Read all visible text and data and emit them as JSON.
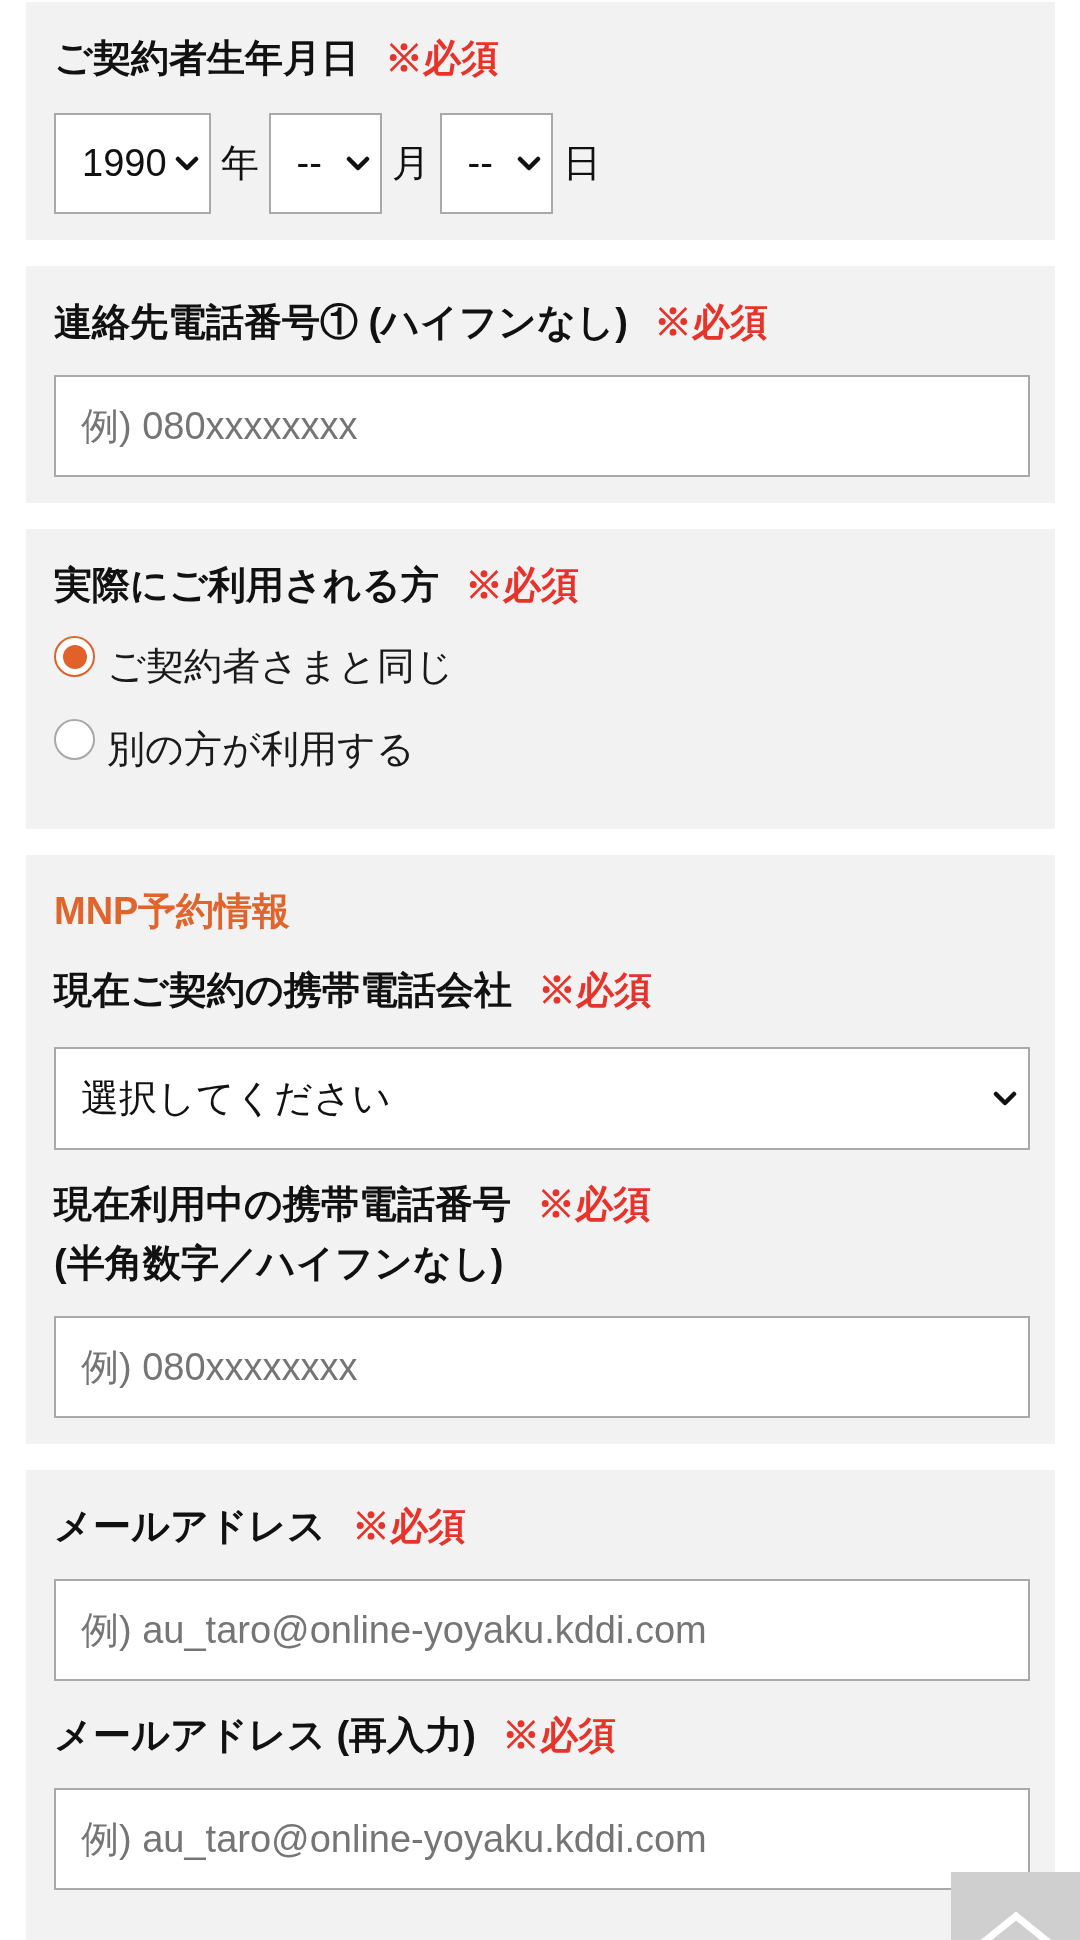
{
  "sections": [
    {
      "fields": [
        {
          "kind": "date",
          "label": "ご契約者生年月日",
          "required": "※必須",
          "selects": [
            {
              "value": "1990",
              "unit": "年"
            },
            {
              "value": "--",
              "unit": "月"
            },
            {
              "value": "--",
              "unit": "日"
            }
          ]
        }
      ]
    },
    {
      "fields": [
        {
          "kind": "text",
          "label": "連絡先電話番号① (ハイフンなし)",
          "required": "※必須",
          "placeholder": "例) 080xxxxxxxx"
        }
      ]
    },
    {
      "fields": [
        {
          "kind": "radio",
          "label": "実際にご利用される方",
          "required": "※必須",
          "options": [
            {
              "label": "ご契約者さまと同じ",
              "selected": true
            },
            {
              "label": "別の方が利用する",
              "selected": false
            }
          ]
        }
      ]
    },
    {
      "heading": "MNP予約情報",
      "fields": [
        {
          "kind": "select",
          "label": "現在ご契約の携帯電話会社",
          "required": "※必須",
          "value": "選択してください"
        },
        {
          "kind": "text",
          "label": "現在利用中の携帯電話番号",
          "required": "※必須",
          "note": "(半角数字／ハイフンなし)",
          "placeholder": "例) 080xxxxxxxx"
        }
      ]
    },
    {
      "fields": [
        {
          "kind": "text",
          "label": "メールアドレス",
          "required": "※必須",
          "placeholder": "例) au_taro@online-yoyaku.kddi.com"
        },
        {
          "kind": "text",
          "label": "メールアドレス (再入力)",
          "required": "※必須",
          "placeholder": "例) au_taro@online-yoyaku.kddi.com"
        }
      ]
    }
  ]
}
